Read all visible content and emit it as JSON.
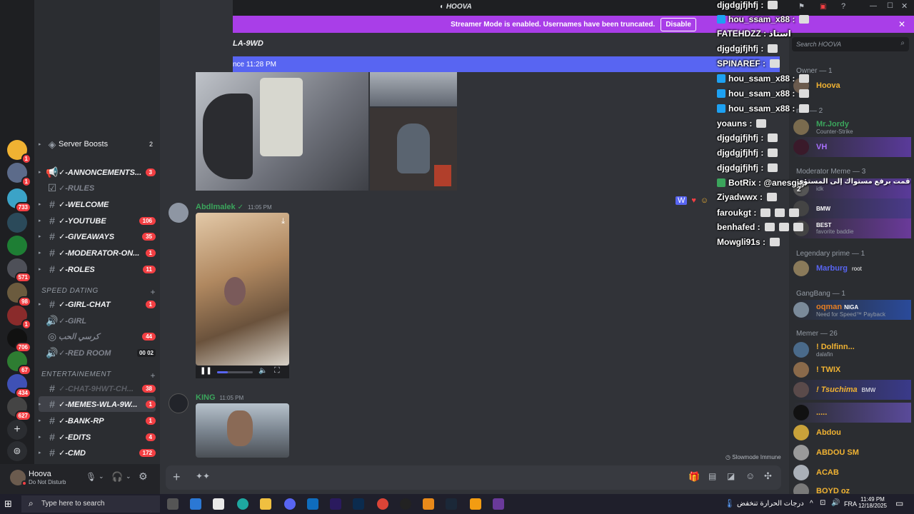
{
  "app": {
    "server_title": "HOOVA"
  },
  "streamer_bar": {
    "text": "Streamer Mode is enabled. Usernames have been truncated.",
    "button": "Disable"
  },
  "channel_header": {
    "title": "LA-9WD",
    "new_since": "nce 11:28 PM"
  },
  "sidebar": {
    "server_boosts": {
      "label": "Server Boosts",
      "count": "2"
    },
    "channels": [
      {
        "name": "✓-ANNONCEMENTS...",
        "badge": "3"
      },
      {
        "name": "✓-RULES",
        "badge": ""
      },
      {
        "name": "✓-WELCOME",
        "badge": ""
      },
      {
        "name": "✓-YOUTUBE",
        "badge": "106"
      },
      {
        "name": "✓-GIVEAWAYS",
        "badge": "35"
      },
      {
        "name": "✓-MODERATOR-ON...",
        "badge": "1"
      },
      {
        "name": "✓-ROLES",
        "badge": "11"
      }
    ],
    "category1": "SPEED DATING",
    "channels2": [
      {
        "name": "✓-GIRL-CHAT",
        "badge": "1"
      },
      {
        "name": "✓-GIRL",
        "badge": ""
      },
      {
        "name": "كرسي الحب",
        "badge": "44"
      },
      {
        "name": "✓-RED ROOM",
        "badge": ""
      }
    ],
    "red_room_counts": [
      "00",
      "02"
    ],
    "category2": "ENTERTAINEMENT",
    "channels3": [
      {
        "name": "✓-CHAT-9HWT-CH...",
        "badge": "38"
      },
      {
        "name": "✓-MEMES-WLA-9W...",
        "badge": "1"
      },
      {
        "name": "✓-BANK-RP",
        "badge": "1"
      },
      {
        "name": "✓-EDITS",
        "badge": "4"
      },
      {
        "name": "✓-CMD",
        "badge": "172"
      }
    ]
  },
  "server_badges": [
    "1",
    "1",
    "733",
    "571",
    "98",
    "1",
    "706",
    "67",
    "434",
    "627"
  ],
  "user_panel": {
    "name": "Hoova",
    "status": "Do Not Disturb"
  },
  "messages": [
    {
      "author": "Abdlmalek",
      "time": "11:05 PM",
      "color": "#3ba55c"
    },
    {
      "author": "KING",
      "time": "11:05 PM",
      "color": "#3ba55c"
    }
  ],
  "slowmode": "Slowmode Immune",
  "search": {
    "placeholder": "Search HOOVA"
  },
  "members": {
    "groups": [
      "Owner — 1",
      "min — 2",
      "Moderator Meme — 3",
      "Legendary prime — 1",
      "GangBang — 1",
      "Memer — 26"
    ],
    "list": [
      {
        "name": "Hoova",
        "sub": "",
        "color": "#f0b232"
      },
      {
        "name": "Mr.Jordy",
        "sub": "Counter-Strike",
        "color": "#3ba55c"
      },
      {
        "name": "VH",
        "sub": "",
        "color": "#a970ff"
      },
      {
        "name": "",
        "sub": "idk",
        "color": "#c27c0e"
      },
      {
        "name": "BMW",
        "sub": "",
        "color": "#c27c0e"
      },
      {
        "name": "BEST",
        "sub": "favorite baddie",
        "color": "#c27c0e"
      },
      {
        "name": "Marburg",
        "sub": "",
        "color": "#5865f2"
      },
      {
        "name": "root",
        "sub": "",
        "color": "#fff"
      },
      {
        "name": "oqman",
        "sub": "Need for Speed™ Payback",
        "color": "#e67e22"
      },
      {
        "name": "NIGA",
        "sub": "",
        "color": "#fff"
      },
      {
        "name": "! Dolfinn...",
        "sub": "dalafin",
        "color": "#f0b232"
      },
      {
        "name": "! TWIX",
        "sub": "",
        "color": "#f0b232"
      },
      {
        "name": "! Tsuchima",
        "sub": "",
        "color": "#f0b232"
      },
      {
        "name": "BMW",
        "sub": "",
        "color": "#fff"
      },
      {
        "name": ".....",
        "sub": "",
        "color": "#f0b232"
      },
      {
        "name": "Abdou",
        "sub": "",
        "color": "#f0b232"
      },
      {
        "name": "ABDOU SM",
        "sub": "",
        "color": "#f0b232"
      },
      {
        "name": "ACAB",
        "sub": "",
        "color": "#f0b232"
      },
      {
        "name": "BOYD oz",
        "sub": "",
        "color": "#f0b232"
      }
    ]
  },
  "overlay_chat": [
    "djgdgjfjhfj :",
    "hou_ssam_x88 :",
    "FATEHDZZ : استاذ",
    "djgdgjfjhfj :",
    "SPINAREF :",
    "hou_ssam_x88 :",
    "hou_ssam_x88 :",
    "hou_ssam_x88 :",
    "yoauns :",
    "djgdgjfjhfj :",
    "djgdgjfjhfj :",
    "djgdgjfjhfj :",
    "BotRix : @anesgigi",
    "Ziyadwwx :",
    "faroukgt :",
    "benhafed :",
    "Mowgli91s :"
  ],
  "overlay_arabic": "قمت برفع مستواك إلى المستوى 2",
  "taskbar": {
    "search_placeholder": "Type here to search",
    "weather": "درجات الحرارة تنخفض",
    "lang": "FRA",
    "time": "11:49 PM",
    "date": "12/18/2025"
  },
  "colors": {
    "accent": "#5865f2",
    "streamer": "#a93ee8",
    "dnd": "#f23f43"
  }
}
